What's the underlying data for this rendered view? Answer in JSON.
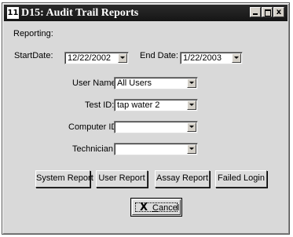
{
  "window": {
    "icon_glyph": "11",
    "title": "D15: Audit Trail Reports",
    "controls": {
      "minimize": "_",
      "maximize": "□",
      "close": "x"
    }
  },
  "form": {
    "section_label": "Reporting:",
    "start_date": {
      "label": "StartDate:",
      "value": "12/22/2002"
    },
    "end_date": {
      "label": "End Date:",
      "value": "1/22/2003"
    },
    "user_name": {
      "label": "User Name:",
      "value": "All Users"
    },
    "test_id": {
      "label": "Test ID:",
      "value": "tap water 2"
    },
    "computer_id": {
      "label": "Computer ID:",
      "value": ""
    },
    "technician": {
      "label": "Technician:",
      "value": ""
    }
  },
  "buttons": {
    "system_report": "System Report",
    "user_report": "User Report",
    "assay_report": "Assay Report",
    "failed_login": "Failed Login",
    "cancel": "Cancel",
    "cancel_icon": "X"
  }
}
